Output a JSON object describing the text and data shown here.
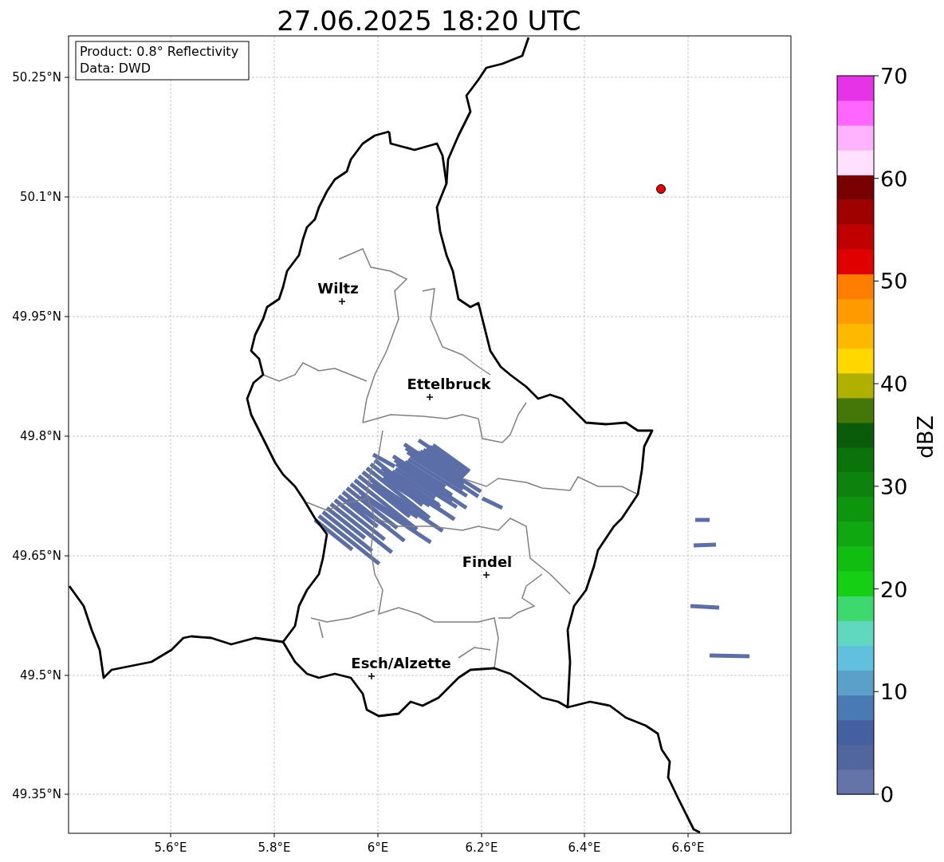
{
  "title": "27.06.2025 18:20 UTC",
  "info_box": [
    "Product: 0.8° Reflectivity",
    "Data: DWD"
  ],
  "map": {
    "xtick_labels": [
      "5.6°E",
      "5.8°E",
      "6°E",
      "6.2°E",
      "6.4°E",
      "6.6°E"
    ],
    "ytick_labels": [
      "50.25°N",
      "50.1°N",
      "49.95°N",
      "49.8°N",
      "49.65°N",
      "49.5°N",
      "49.35°N"
    ],
    "cities": [
      {
        "name": "Wiltz"
      },
      {
        "name": "Ettelbruck"
      },
      {
        "name": "Findel"
      },
      {
        "name": "Esch/Alzette"
      }
    ]
  },
  "colorbar": {
    "label": "dBZ",
    "tick_labels": [
      "70",
      "60",
      "50",
      "40",
      "30",
      "20",
      "10",
      "0"
    ],
    "segments": [
      {
        "color": "#6474a8"
      },
      {
        "color": "#52669e"
      },
      {
        "color": "#4460a0"
      },
      {
        "color": "#4a7ab3"
      },
      {
        "color": "#5aa0c8"
      },
      {
        "color": "#60c0dd"
      },
      {
        "color": "#60d8c0"
      },
      {
        "color": "#3dd86e"
      },
      {
        "color": "#14cf14"
      },
      {
        "color": "#12bd12"
      },
      {
        "color": "#10a810"
      },
      {
        "color": "#0d960d"
      },
      {
        "color": "#0d820d"
      },
      {
        "color": "#0a730a"
      },
      {
        "color": "#0a5c0a"
      },
      {
        "color": "#457708"
      },
      {
        "color": "#b0b000"
      },
      {
        "color": "#ffd800"
      },
      {
        "color": "#ffb800"
      },
      {
        "color": "#ff9a00"
      },
      {
        "color": "#ff7d00"
      },
      {
        "color": "#e00000"
      },
      {
        "color": "#c00000"
      },
      {
        "color": "#9f0000"
      },
      {
        "color": "#780000"
      },
      {
        "color": "#ffe0ff"
      },
      {
        "color": "#ffb3ff"
      },
      {
        "color": "#ff66ff"
      },
      {
        "color": "#e733e7"
      }
    ]
  }
}
